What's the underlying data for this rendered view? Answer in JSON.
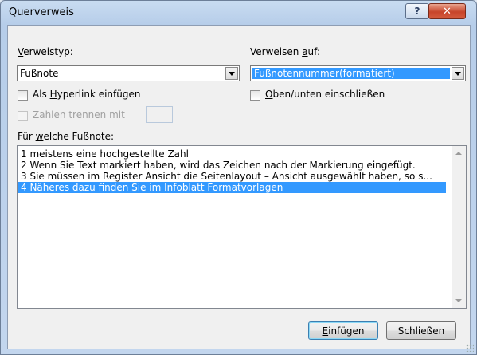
{
  "window": {
    "title": "Querverweis",
    "help": "?",
    "close": "✕"
  },
  "reftype": {
    "label_u": "V",
    "label_rest": "erweistyp:",
    "value": "Fußnote"
  },
  "refer_to": {
    "label_pre": "Verweisen ",
    "label_u": "a",
    "label_rest": "uf:",
    "value": "Fußnotennummer(formatiert)"
  },
  "hyperlink": {
    "label_pre": "Als ",
    "label_u": "H",
    "label_rest": "yperlink einfügen"
  },
  "above_below": {
    "label_u": "O",
    "label_rest": "ben/unten einschließen"
  },
  "separate": {
    "label": "Zahlen trennen mit"
  },
  "for_which": {
    "label_pre": "Für ",
    "label_u": "w",
    "label_rest": "elche Fußnote:"
  },
  "list": {
    "items": [
      "1  meistens eine hochgestellte Zahl",
      "2  Wenn Sie Text markiert haben, wird das Zeichen nach der Markierung eingefügt.",
      "3  Sie müssen im Register Ansicht die Seitenlayout – Ansicht ausgewählt haben, so s...",
      "4  Näheres dazu finden Sie im Infoblatt Formatvorlagen"
    ],
    "selected_index": 3
  },
  "buttons": {
    "insert_u": "E",
    "insert_rest": "infügen",
    "close": "Schließen"
  },
  "colors": {
    "selection": "#3399ff",
    "dialog_bg": "#f0f0f0"
  }
}
